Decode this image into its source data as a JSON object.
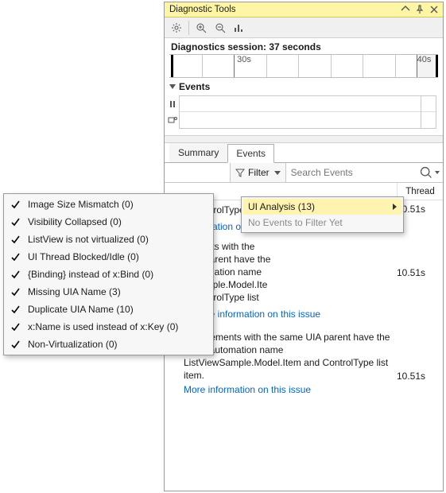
{
  "window": {
    "title": "Diagnostic Tools"
  },
  "session": {
    "label": "Diagnostics session: 37 seconds"
  },
  "ruler": {
    "labels": {
      "l30": "30s",
      "l40": "40s"
    }
  },
  "events_section": {
    "title": "Events"
  },
  "tabs": {
    "summary": "Summary",
    "events": "Events"
  },
  "filter": {
    "label": "Filter"
  },
  "search": {
    "placeholder": "Search Events"
  },
  "columns": {
    "thread": "Thread"
  },
  "filter_menu": {
    "ui_analysis": "UI Analysis (13)",
    "no_events": "No Events to Filter Yet"
  },
  "categories": [
    {
      "label": "Image Size Mismatch (0)"
    },
    {
      "label": "Visibility Collapsed (0)"
    },
    {
      "label": "ListView is not virtualized (0)"
    },
    {
      "label": "UI Thread Blocked/Idle (0)"
    },
    {
      "label": "{Binding} instead of x:Bind (0)"
    },
    {
      "label": "Missing UIA Name (3)"
    },
    {
      "label": "Duplicate UIA Name (10)"
    },
    {
      "label": "x:Name is used instead of x:Key (0)"
    },
    {
      "label": "Non-Virtualization (0)"
    }
  ],
  "partial": {
    "l0": "ControlType list",
    "t0": "10.51s",
    "link0": "formation on this",
    "l1a": "ments with the",
    "l1b": "IA parent have the",
    "l1c": "utomation name",
    "l1d": "Sample.Model.Ite",
    "l1e": "ControlType list",
    "t1": "10.51s",
    "link1": "More information on this issue"
  },
  "issue2": {
    "text": "UIA Elements with the same UIA parent have the same automation name ListViewSample.Model.Item and ControlType list item.",
    "link": "More information on this issue",
    "time": "10.51s"
  }
}
